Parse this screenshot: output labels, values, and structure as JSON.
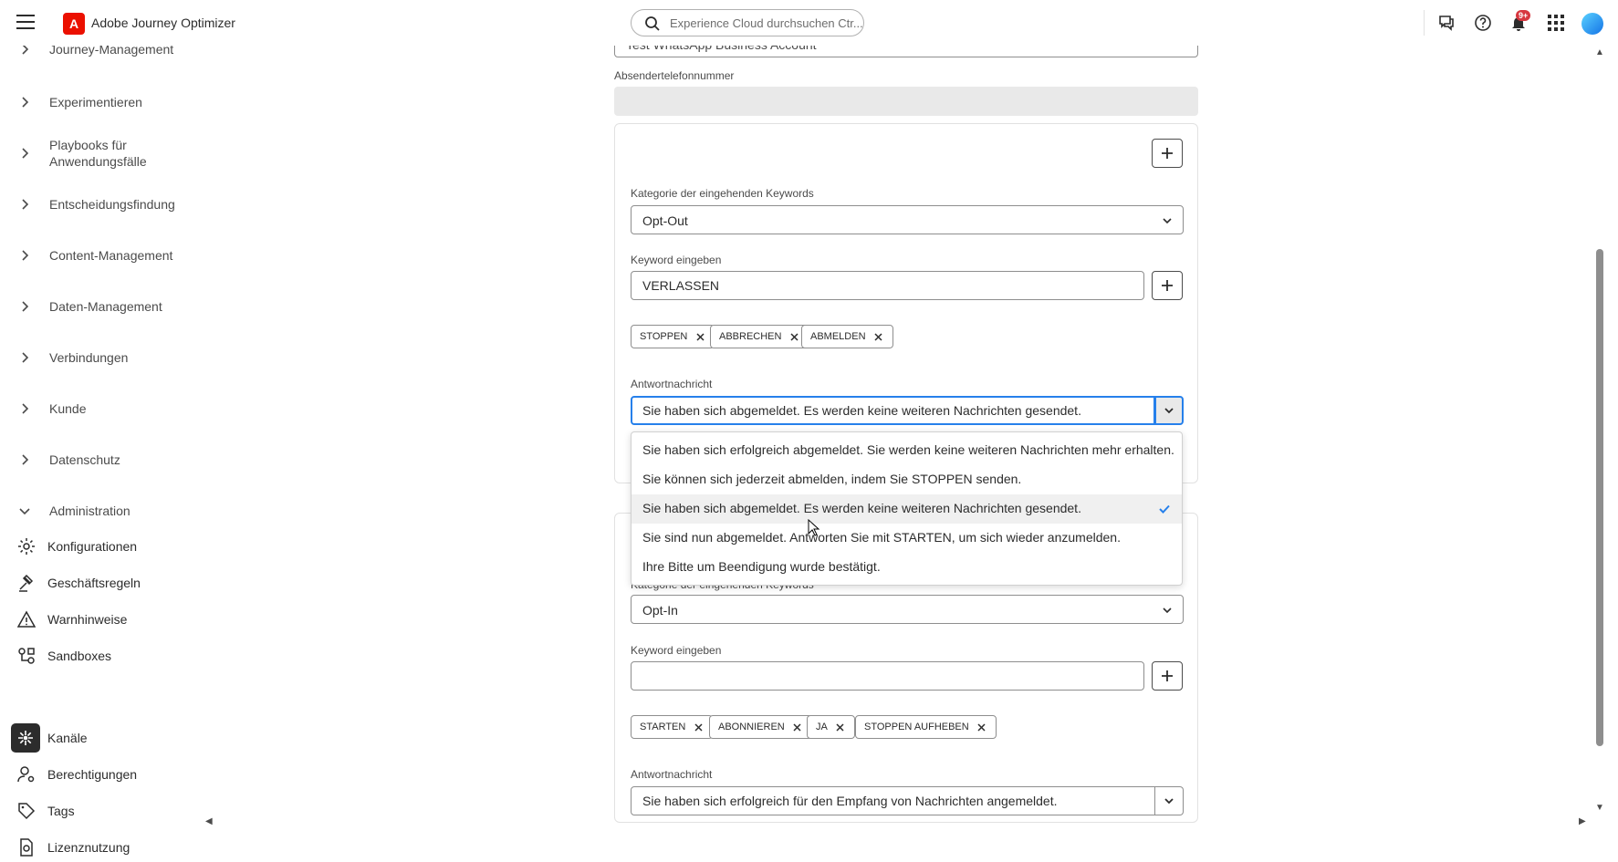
{
  "app": {
    "name": "Adobe Journey Optimizer"
  },
  "search": {
    "placeholder": "Experience Cloud durchsuchen Ctr..."
  },
  "notifications": {
    "badge": "9+"
  },
  "sidebar": {
    "groups": [
      {
        "label": "Journey-Management",
        "expanded": false
      },
      {
        "label": "Experimentieren",
        "expanded": false
      },
      {
        "label": "Playbooks für",
        "label2": "Anwendungsfälle",
        "expanded": false
      },
      {
        "label": "Entscheidungsfindung",
        "expanded": false
      },
      {
        "label": "Content-Management",
        "expanded": false
      },
      {
        "label": "Daten-Management",
        "expanded": false
      },
      {
        "label": "Verbindungen",
        "expanded": false
      },
      {
        "label": "Kunde",
        "expanded": false
      },
      {
        "label": "Datenschutz",
        "expanded": false
      },
      {
        "label": "Administration",
        "expanded": true
      }
    ],
    "admin_items": [
      {
        "label": "Konfigurationen",
        "icon": "configuration-icon"
      },
      {
        "label": "Geschäftsregeln",
        "icon": "gavel-icon"
      },
      {
        "label": "Warnhinweise",
        "icon": "alert-icon"
      },
      {
        "label": "Sandboxes",
        "icon": "sandbox-icon"
      },
      {
        "label": "Kanäle",
        "icon": "channels-icon",
        "active": true
      },
      {
        "label": "Berechtigungen",
        "icon": "permissions-icon"
      },
      {
        "label": "Tags",
        "icon": "tag-icon"
      },
      {
        "label": "Lizenznutzung",
        "icon": "license-icon"
      }
    ]
  },
  "form": {
    "account_value": "Test WhatsApp Business Account",
    "sender_phone_label": "Absendertelefonnummer",
    "sender_phone_value": "",
    "optout": {
      "category_label": "Kategorie der eingehenden Keywords",
      "category_value": "Opt-Out",
      "keyword_label": "Keyword eingeben",
      "keyword_value": "VERLASSEN",
      "tags": [
        "STOPPEN",
        "ABBRECHEN",
        "ABMELDEN"
      ],
      "reply_label": "Antwortnachricht",
      "reply_value": "Sie haben sich abgemeldet. Es werden keine weiteren Nachrichten gesendet."
    },
    "optin": {
      "category_label": "Kategorie der eingehenden Keywords",
      "category_value": "Opt-In",
      "keyword_label": "Keyword eingeben",
      "keyword_value": "",
      "tags": [
        "STARTEN",
        "ABONNIEREN",
        "JA",
        "STOPPEN AUFHEBEN"
      ],
      "reply_label": "Antwortnachricht",
      "reply_value": "Sie haben sich erfolgreich für den Empfang von Nachrichten angemeldet."
    }
  },
  "dropdown": {
    "options": [
      "Sie haben sich erfolgreich abgemeldet. Sie werden keine weiteren Nachrichten mehr erhalten.",
      "Sie können sich jederzeit abmelden, indem Sie STOPPEN senden.",
      "Sie haben sich abgemeldet. Es werden keine weiteren Nachrichten gesendet.",
      "Sie sind nun abgemeldet. Antworten Sie mit STARTEN, um sich wieder anzumelden.",
      "Ihre Bitte um Beendigung wurde bestätigt."
    ],
    "selected_index": 2
  },
  "colors": {
    "accent": "#2680eb",
    "brand": "#eb1000",
    "badge": "#d7373f"
  }
}
